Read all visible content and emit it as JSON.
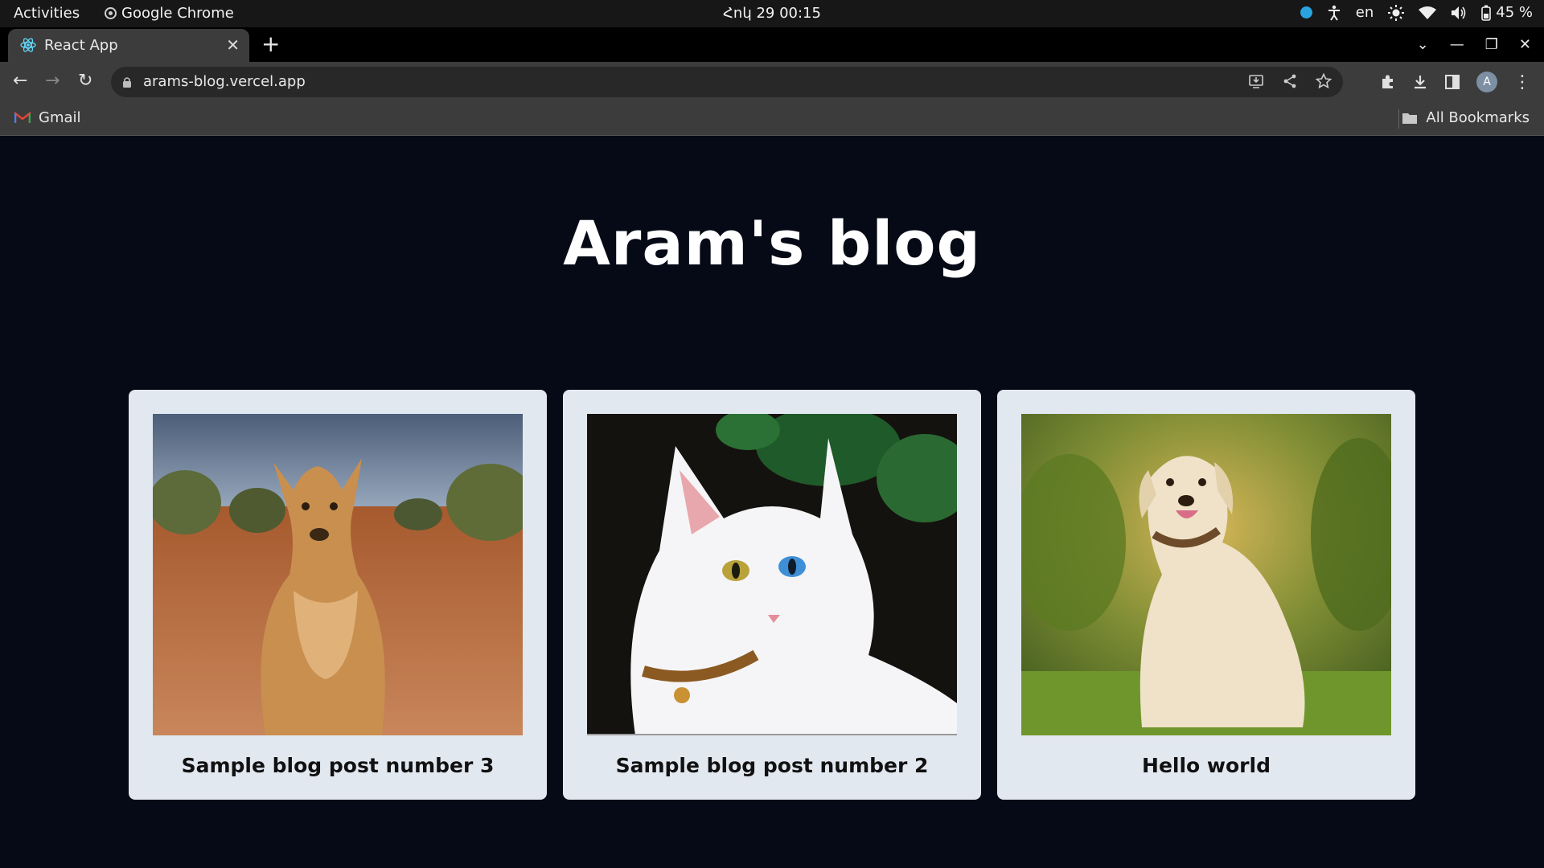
{
  "system_bar": {
    "activities": "Activities",
    "app_name": "Google Chrome",
    "datetime": "Հոկ 29  00:15",
    "language": "en",
    "battery": "45 %"
  },
  "browser": {
    "tab_title": "React App",
    "url": "arams-blog.vercel.app",
    "avatar_letter": "A",
    "bookmarks": {
      "gmail": "Gmail",
      "all": "All Bookmarks"
    }
  },
  "blog": {
    "title": "Aram's blog",
    "posts": [
      {
        "title": "Sample blog post number 3",
        "image": "kangaroo"
      },
      {
        "title": "Sample blog post number 2",
        "image": "white-cat"
      },
      {
        "title": "Hello world",
        "image": "labrador-dog"
      }
    ]
  }
}
